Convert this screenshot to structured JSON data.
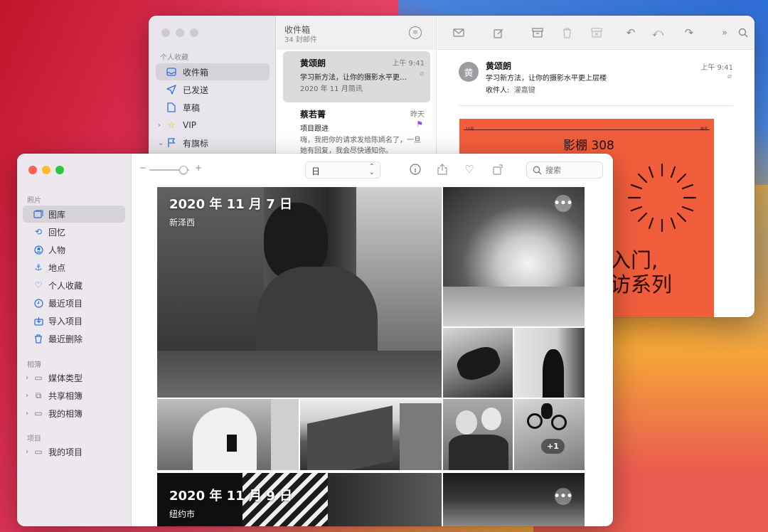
{
  "mail": {
    "sidebar": {
      "section": "个人收藏",
      "items": [
        {
          "label": "收件箱",
          "icon": "inbox-icon",
          "selected": true
        },
        {
          "label": "已发送",
          "icon": "paperplane-icon"
        },
        {
          "label": "草稿",
          "icon": "doc-icon"
        },
        {
          "label": "VIP",
          "icon": "star-icon"
        },
        {
          "label": "有旗标",
          "icon": "flag-icon"
        }
      ]
    },
    "mailbox": {
      "title": "收件箱",
      "count": "34 封邮件"
    },
    "messages": [
      {
        "from": "黄颂朗",
        "time": "上午 9:41",
        "subject": "学习新方法，让你的摄影水平更…",
        "preview": "2020 年 11 月简讯",
        "selected": true
      },
      {
        "from": "蔡若菁",
        "time": "昨天",
        "subject": "项目跟进",
        "preview": "嗨，我把你的请求发给陈嫣名了，一旦她有回复，我会尽快通知你。"
      }
    ],
    "reader": {
      "avatar": "黄",
      "from": "黄颂朗",
      "subject": "学习新方法，让你的摄影水平更上层楼",
      "to_label": "收件人:",
      "to": "灌嘉键",
      "time": "上午 9:41",
      "poster": {
        "month": "11月",
        "label": "简讯",
        "title": "影棚 308",
        "line1": "入门,",
        "line2": "访系列"
      }
    }
  },
  "photos": {
    "sidebar": {
      "photos_section": "照片",
      "items": [
        {
          "label": "图库",
          "icon": "library-icon",
          "selected": true
        },
        {
          "label": "回忆",
          "icon": "memories-icon"
        },
        {
          "label": "人物",
          "icon": "people-icon"
        },
        {
          "label": "地点",
          "icon": "places-icon"
        },
        {
          "label": "个人收藏",
          "icon": "heart-icon"
        },
        {
          "label": "最近项目",
          "icon": "clock-icon"
        },
        {
          "label": "导入项目",
          "icon": "import-icon"
        },
        {
          "label": "最近删除",
          "icon": "trash-icon"
        }
      ],
      "albums_section": "相簿",
      "albums": [
        {
          "label": "媒体类型"
        },
        {
          "label": "共享相簿"
        },
        {
          "label": "我的相簿"
        }
      ],
      "projects_section": "项目",
      "projects": [
        {
          "label": "我的项目"
        }
      ]
    },
    "toolbar": {
      "zoom_minus": "−",
      "zoom_plus": "+",
      "zoom_level": 0.85,
      "view": "日",
      "search_placeholder": "搜索"
    },
    "days": [
      {
        "date": "2020 年 11 月 7 日",
        "place": "新泽西"
      },
      {
        "date": "2020 年 11 月 9 日",
        "place": "纽约市"
      }
    ],
    "more_badge": "+1",
    "more_button": "•••"
  }
}
